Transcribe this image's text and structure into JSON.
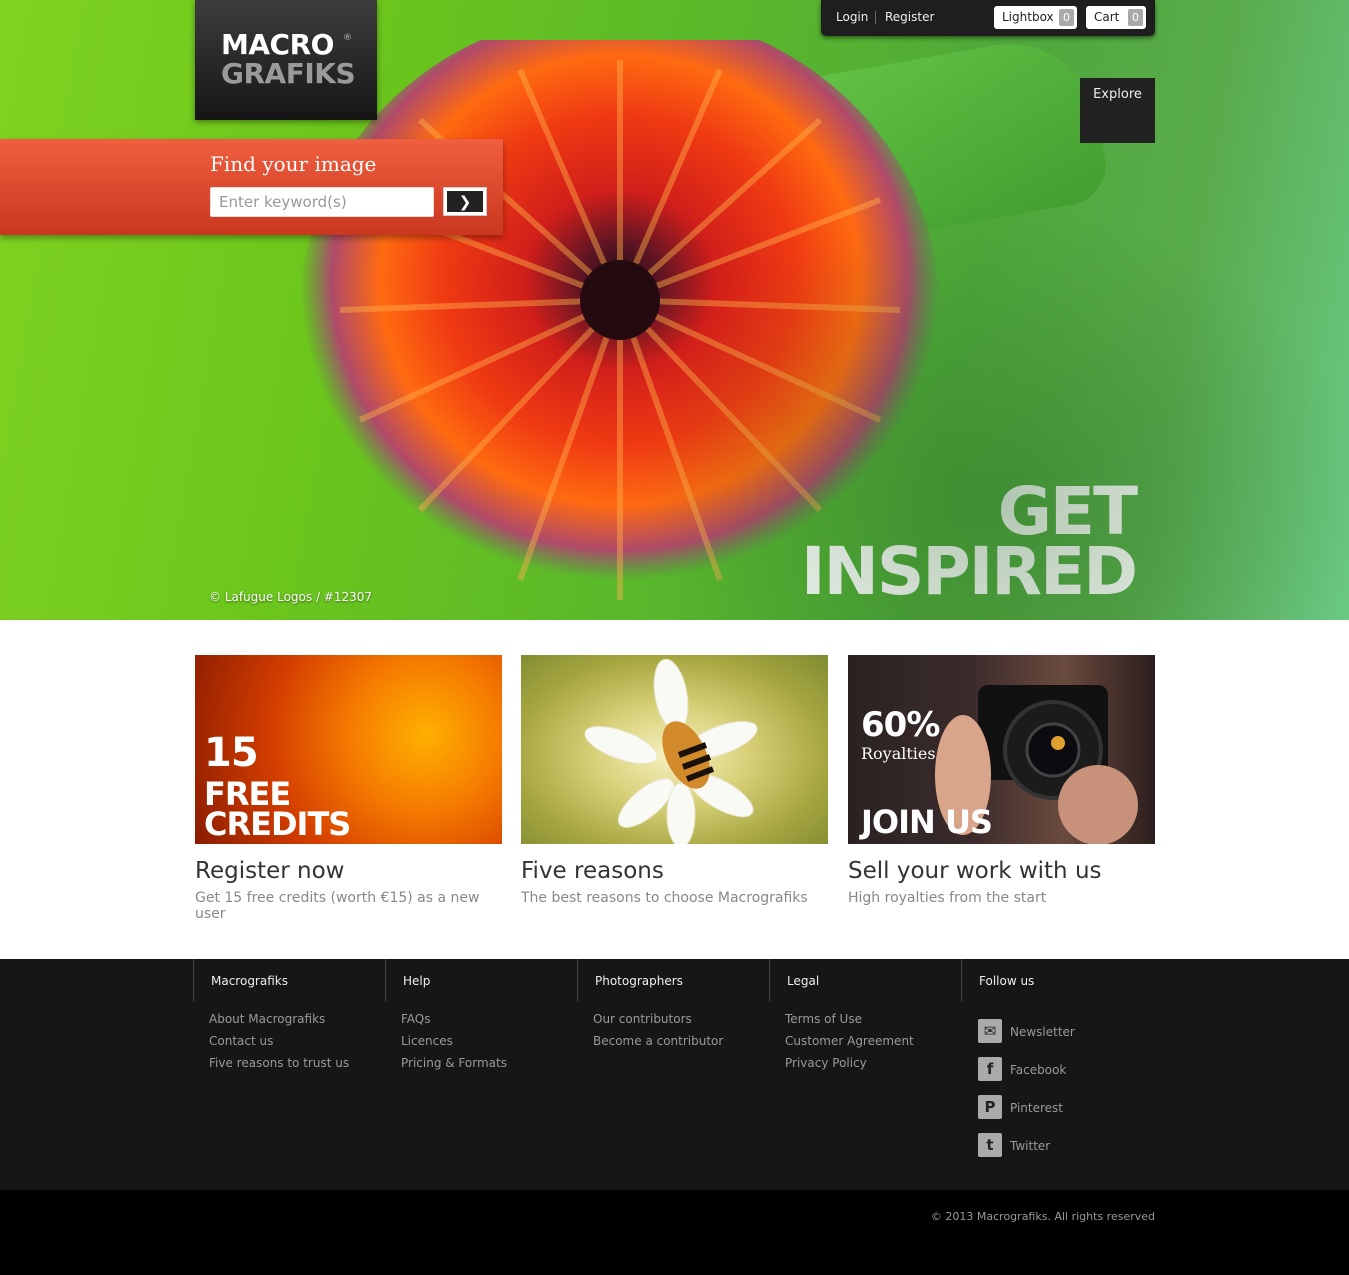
{
  "logo": {
    "line1": "MACRO",
    "line2": "GRAFIKS",
    "reg": "®"
  },
  "topbar": {
    "login": "Login",
    "register": "Register",
    "lightbox": "Lightbox",
    "lightbox_count": "0",
    "cart": "Cart",
    "cart_count": "0"
  },
  "explore": "Explore",
  "search": {
    "title": "Find your image",
    "placeholder": "Enter keyword(s)",
    "go_icon": "❯"
  },
  "hero": {
    "credit": "© Lafugue Logos / #12307",
    "headline1": "GET",
    "headline2": "INSPIRED"
  },
  "cards": [
    {
      "overlay1": "15",
      "overlay2": "FREE",
      "overlay3": "CREDITS",
      "title": "Register now",
      "subtitle": "Get 15 free credits (worth €15) as a new user"
    },
    {
      "title": "Five reasons",
      "subtitle": "The best reasons to choose Macrografiks"
    },
    {
      "overlay1": "60%",
      "overlay2": "Royalties",
      "overlay3": "JOIN US",
      "title": "Sell your work with us",
      "subtitle": "High royalties from the start"
    }
  ],
  "footer": {
    "columns": [
      {
        "head": "Macrografiks",
        "items": [
          "About Macrografiks",
          "Contact us",
          "Five reasons to trust us"
        ]
      },
      {
        "head": "Help",
        "items": [
          "FAQs",
          "Licences",
          "Pricing & Formats"
        ]
      },
      {
        "head": "Photographers",
        "items": [
          "Our contributors",
          "Become a contributor"
        ]
      },
      {
        "head": "Legal",
        "items": [
          "Terms of Use",
          "Customer Agreement",
          "Privacy Policy"
        ]
      },
      {
        "head": "Follow us",
        "social": [
          {
            "label": "Newsletter",
            "icon": "envelope-icon"
          },
          {
            "label": "Facebook",
            "icon": "facebook-icon"
          },
          {
            "label": "Pinterest",
            "icon": "pinterest-icon"
          },
          {
            "label": "Twitter",
            "icon": "twitter-icon"
          }
        ]
      }
    ],
    "copyright": "© 2013 Macrografiks. All rights reserved"
  }
}
